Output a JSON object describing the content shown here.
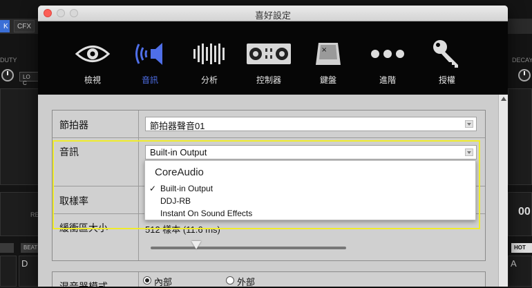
{
  "window": {
    "title": "喜好設定"
  },
  "background": {
    "tabs": [
      "K",
      "CFX"
    ],
    "labels": {
      "left_knob": "DUTY",
      "right_knob": "DECAY",
      "lo": "LO C",
      "re": "RE",
      "beat": "BEAT",
      "hot": "HOT",
      "deck_left": "D",
      "deck_right": "A",
      "counter": "00"
    }
  },
  "toolbar": {
    "items": [
      {
        "label": "檢視",
        "icon": "eye-icon"
      },
      {
        "label": "音訊",
        "icon": "speaker-icon"
      },
      {
        "label": "分析",
        "icon": "waveform-icon"
      },
      {
        "label": "控制器",
        "icon": "controller-icon"
      },
      {
        "label": "鍵盤",
        "icon": "keyboard-key-icon"
      },
      {
        "label": "進階",
        "icon": "more-dots-icon"
      },
      {
        "label": "授權",
        "icon": "key-icon"
      }
    ],
    "active_index": 1,
    "active_color": "#4f6fe8"
  },
  "settings": {
    "metronome": {
      "label": "節拍器",
      "value": "節拍器聲音01"
    },
    "audio": {
      "label": "音訊",
      "value": "Built-in Output"
    },
    "sample_rate": {
      "label": "取樣率"
    },
    "buffer": {
      "label": "緩衝區大小",
      "value": "512 樣本 (11.6 ms)"
    },
    "mixer_mode": {
      "label": "混音器模式",
      "options": [
        "內部",
        "外部"
      ],
      "selected": "內部"
    }
  },
  "dropdown": {
    "header": "CoreAudio",
    "items": [
      "Built-in Output",
      "DDJ-RB",
      "Instant On Sound Effects"
    ],
    "selected": "Built-in Output",
    "check_mark": "✓"
  },
  "highlight_color": "#f0ec2a"
}
